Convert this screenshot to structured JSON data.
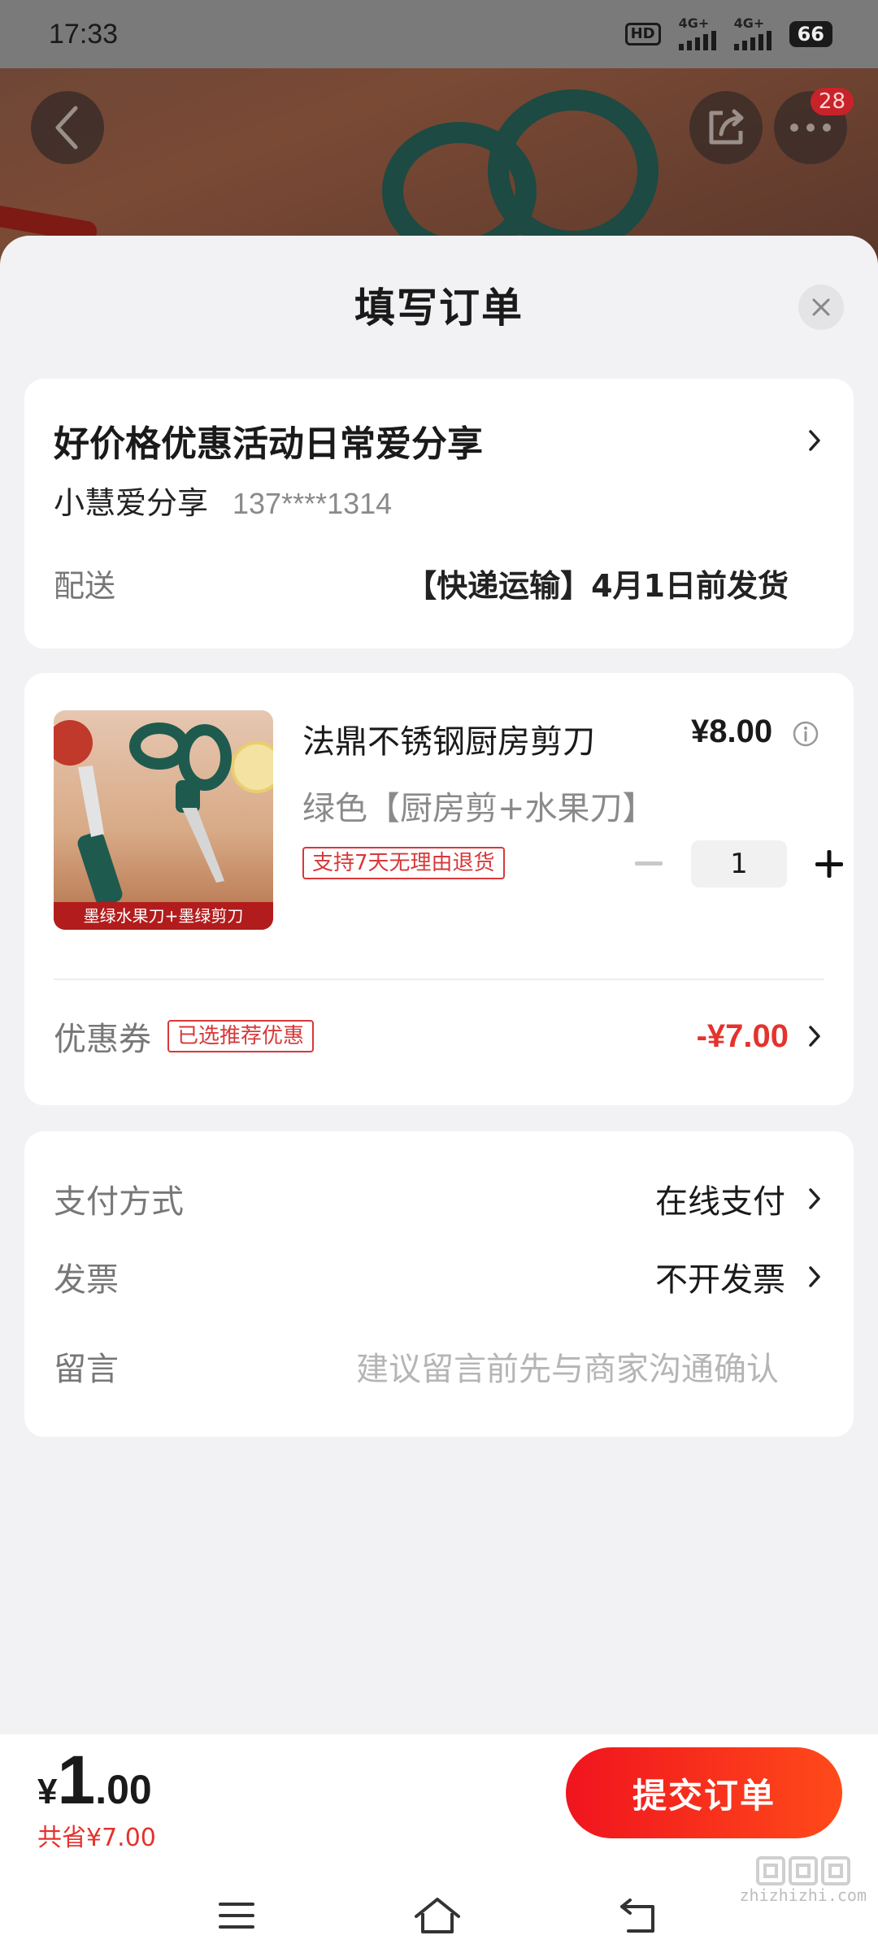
{
  "status_bar": {
    "time": "17:33",
    "hd_label": "HD",
    "net1": "4G+",
    "net2": "4G+",
    "battery": "66"
  },
  "top_actions": {
    "back_icon": "chevron-left-icon",
    "share_icon": "share-icon",
    "more_icon": "more-dots-icon",
    "message_badge": "28"
  },
  "sheet": {
    "title": "填写订单",
    "close_icon": "close-icon"
  },
  "address": {
    "title": "好价格优惠活动日常爱分享",
    "name": "小慧爱分享",
    "phone": "137****1314",
    "shipping_label": "配送",
    "shipping_value": "【快递运输】4月1日前发货"
  },
  "product": {
    "name": "法鼎不锈钢厨房剪刀",
    "price": "¥8.00",
    "spec": "绿色【厨房剪+水果刀】",
    "return_tag": "支持7天无理由退货",
    "image_caption": "墨绿水果刀+墨绿剪刀",
    "quantity": "1",
    "minus_icon": "minus-icon",
    "plus_icon": "plus-icon"
  },
  "coupon": {
    "label": "优惠券",
    "tag": "已选推荐优惠",
    "value": "-¥7.00"
  },
  "options": {
    "payment_label": "支付方式",
    "payment_value": "在线支付",
    "invoice_label": "发票",
    "invoice_value": "不开发票",
    "message_label": "留言",
    "message_placeholder": "建议留言前先与商家沟通确认"
  },
  "bottom": {
    "currency": "¥",
    "total_int": "1",
    "total_dec": ".00",
    "saved": "共省¥7.00",
    "submit_label": "提交订单"
  },
  "watermark": {
    "text": "zhizhizhi.com"
  },
  "colors": {
    "accent": "#e5322d",
    "button_start": "#f0141e",
    "button_end": "#ff4a1a",
    "sheet_bg": "#f2f2f4"
  }
}
